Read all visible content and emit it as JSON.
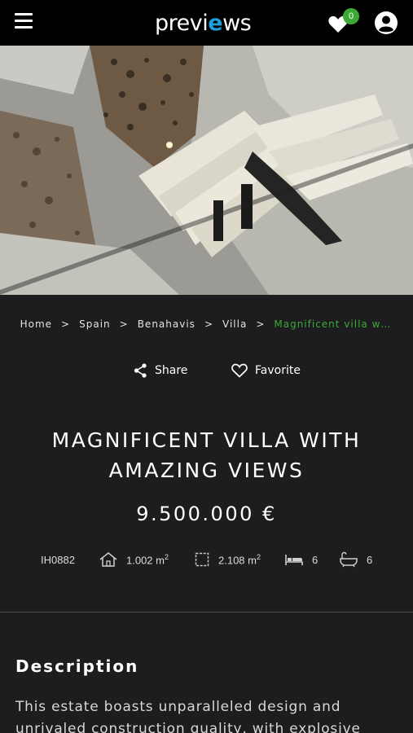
{
  "header": {
    "logo_before": "previ",
    "logo_mark": "e",
    "logo_after": "ws",
    "favorites_count": "0",
    "brand_color": "#1e9fd8",
    "badge_color": "#3aaa35"
  },
  "breadcrumb": {
    "items": [
      "Home",
      "Spain",
      "Benahavis",
      "Villa"
    ],
    "separator": ">",
    "current": "Magnificent villa with amazing views",
    "current_color": "#3aaa35"
  },
  "actions": {
    "share_label": "Share",
    "favorite_label": "Favorite"
  },
  "listing": {
    "title_line1": "MAGNIFICENT VILLA WITH",
    "title_line2": "AMAZING VIEWS",
    "price": "9.500.000 €",
    "reference": "IH0882",
    "built_area": "1.002 m",
    "plot_area": "2.108 m",
    "area_unit_exp": "2",
    "bedrooms": "6",
    "bathrooms": "6"
  },
  "description": {
    "heading": "Description",
    "text": "This estate boasts unparalleled design and unrivaled construction quality, with explosive front-"
  },
  "icons": [
    "menu-icon",
    "heart-icon",
    "account-icon",
    "share-icon",
    "heart-outline-icon",
    "house-icon",
    "plot-icon",
    "bed-icon",
    "bath-icon"
  ]
}
